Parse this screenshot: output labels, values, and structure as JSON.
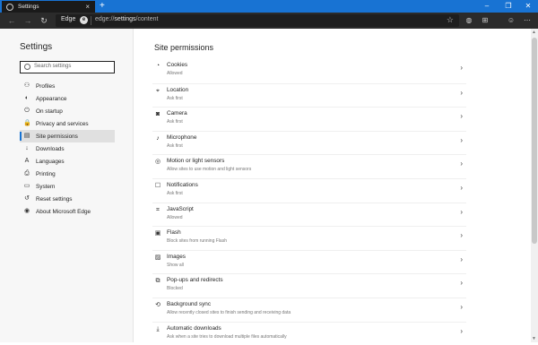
{
  "window": {
    "tab_title": "Settings",
    "tab_close": "×",
    "new_tab": "+",
    "minimize": "–",
    "restore": "❐",
    "close": "✕"
  },
  "toolbar": {
    "brand": "Edge",
    "brand_logo": "e",
    "url_scheme": "edge://",
    "url_path_strong": "settings",
    "url_path_rest": "/content",
    "icons": [
      "back-icon",
      "forward-icon",
      "refresh-icon",
      "favorite-star-icon",
      "collections-icon",
      "favorites-icon",
      "feedback-icon",
      "more-icon"
    ]
  },
  "sidebar": {
    "title": "Settings",
    "search_placeholder": "Search settings",
    "items": [
      {
        "label": "Profiles",
        "icon": "profile-icon",
        "glyph": "⚇"
      },
      {
        "label": "Appearance",
        "icon": "appearance-icon",
        "glyph": "◐"
      },
      {
        "label": "On startup",
        "icon": "power-icon",
        "glyph": "⏻"
      },
      {
        "label": "Privacy and services",
        "icon": "lock-icon",
        "glyph": "🔒"
      },
      {
        "label": "Site permissions",
        "icon": "site-permissions-icon",
        "glyph": "▤",
        "active": true
      },
      {
        "label": "Downloads",
        "icon": "download-icon",
        "glyph": "↓"
      },
      {
        "label": "Languages",
        "icon": "languages-icon",
        "glyph": "A"
      },
      {
        "label": "Printing",
        "icon": "printer-icon",
        "glyph": "⎙"
      },
      {
        "label": "System",
        "icon": "system-icon",
        "glyph": "▭"
      },
      {
        "label": "Reset settings",
        "icon": "reset-icon",
        "glyph": "↺"
      },
      {
        "label": "About Microsoft Edge",
        "icon": "edge-icon",
        "glyph": "◉"
      }
    ]
  },
  "main": {
    "title": "Site permissions",
    "permissions": [
      {
        "title": "Cookies",
        "desc": "Allowed",
        "icon": "cookie-icon",
        "glyph": "◔"
      },
      {
        "title": "Location",
        "desc": "Ask first",
        "icon": "location-icon",
        "glyph": "⌖"
      },
      {
        "title": "Camera",
        "desc": "Ask first",
        "icon": "camera-icon",
        "glyph": "◙"
      },
      {
        "title": "Microphone",
        "desc": "Ask first",
        "icon": "microphone-icon",
        "glyph": "♪"
      },
      {
        "title": "Motion or light sensors",
        "desc": "Allow sites to use motion and light sensors",
        "icon": "sensor-icon",
        "glyph": "◎"
      },
      {
        "title": "Notifications",
        "desc": "Ask first",
        "icon": "notification-icon",
        "glyph": "☐"
      },
      {
        "title": "JavaScript",
        "desc": "Allowed",
        "icon": "javascript-icon",
        "glyph": "⌗"
      },
      {
        "title": "Flash",
        "desc": "Block sites from running Flash",
        "icon": "flash-icon",
        "glyph": "▣"
      },
      {
        "title": "Images",
        "desc": "Show all",
        "icon": "image-icon",
        "glyph": "▨"
      },
      {
        "title": "Pop-ups and redirects",
        "desc": "Blocked",
        "icon": "popup-icon",
        "glyph": "⧉"
      },
      {
        "title": "Background sync",
        "desc": "Allow recently closed sites to finish sending and receiving data",
        "icon": "sync-icon",
        "glyph": "⟲"
      },
      {
        "title": "Automatic downloads",
        "desc": "Ask when a site tries to download multiple files automatically",
        "icon": "auto-download-icon",
        "glyph": "⤓"
      }
    ]
  },
  "colors": {
    "titlebar": "#1873d3",
    "toolbar": "#2b2b2b",
    "active_accent": "#1873d3"
  }
}
